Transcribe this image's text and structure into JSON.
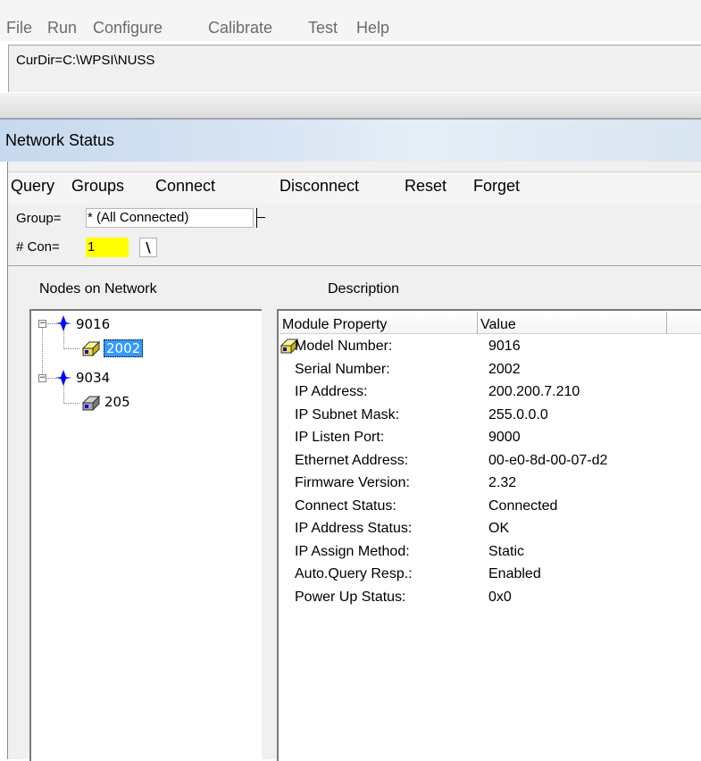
{
  "main_menu": [
    "File",
    "Run",
    "Configure",
    "Calibrate",
    "Test",
    "Help"
  ],
  "curdir": "CurDir=C:\\WPSI\\NUSS",
  "window_title": "Network Status",
  "sub_menu": [
    "Query",
    "Groups",
    "Connect",
    "Disconnect",
    "Reset",
    "Forget"
  ],
  "group": {
    "label": "Group=",
    "value": "* (All Connected)"
  },
  "con": {
    "label": "# Con=",
    "value": "1"
  },
  "cursor_glyph": "\\",
  "nodes_label": "Nodes on Network",
  "description_label": "Description",
  "tree": [
    {
      "label": "9016",
      "children": [
        {
          "label": "2002",
          "selected": true
        }
      ]
    },
    {
      "label": "9034",
      "children": [
        {
          "label": "205",
          "selected": false
        }
      ]
    }
  ],
  "list_headers": [
    "Module Property",
    "Value"
  ],
  "properties": [
    {
      "name": "Model Number:",
      "value": "9016"
    },
    {
      "name": "Serial Number:",
      "value": "2002"
    },
    {
      "name": "IP Address:",
      "value": "200.200.7.210"
    },
    {
      "name": "IP Subnet Mask:",
      "value": "255.0.0.0"
    },
    {
      "name": "IP Listen Port:",
      "value": "9000"
    },
    {
      "name": "Ethernet Address:",
      "value": "00-e0-8d-00-07-d2"
    },
    {
      "name": "Firmware Version:",
      "value": "2.32"
    },
    {
      "name": "Connect Status:",
      "value": "Connected"
    },
    {
      "name": "IP Address Status:",
      "value": "OK"
    },
    {
      "name": "IP Assign Method:",
      "value": "Static"
    },
    {
      "name": "Auto.Query Resp.:",
      "value": "Enabled"
    },
    {
      "name": "Power Up Status:",
      "value": "0x0"
    }
  ],
  "colors": {
    "network_icon": "#0000ff",
    "selected_bg": "#3399ff",
    "con_field": "#ffff00",
    "module_icon": "#f5e03a"
  }
}
